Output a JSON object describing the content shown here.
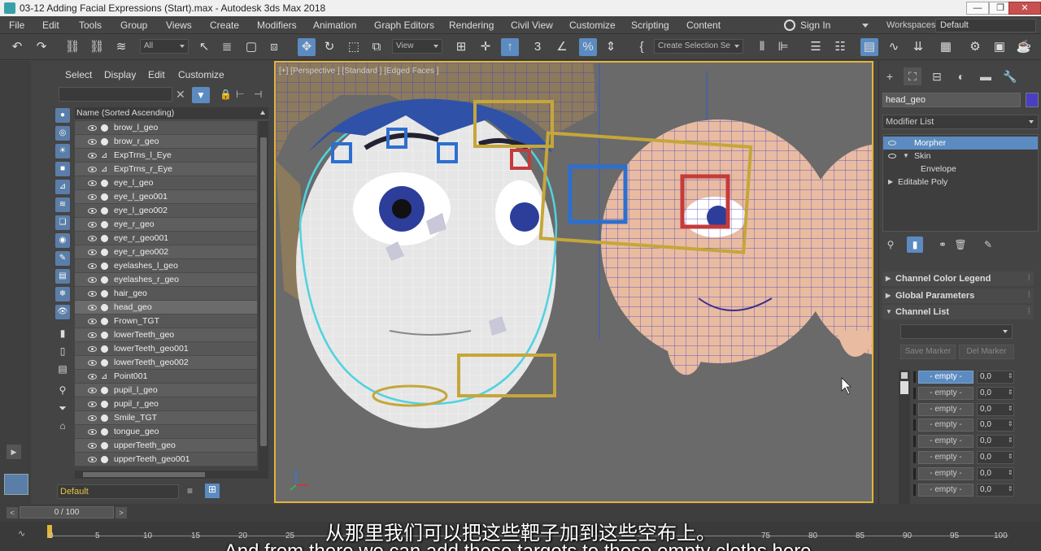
{
  "app": {
    "title": "03-12 Adding Facial Expressions (Start).max - Autodesk 3ds Max 2018",
    "window_buttons": [
      "—",
      "❐",
      "✕"
    ]
  },
  "menubar": {
    "items": [
      "File",
      "Edit",
      "Tools",
      "Group",
      "Views",
      "Create",
      "Modifiers",
      "Animation",
      "Graph Editors",
      "Rendering",
      "Civil View",
      "Customize",
      "Scripting",
      "Content"
    ],
    "sign_in": "Sign In",
    "workspaces_label": "Workspaces:",
    "workspace_value": "Default"
  },
  "toolbar": {
    "selection_filter": "All",
    "ref_coord": "View",
    "named_selection": "Create Selection Se",
    "snap_label": "3"
  },
  "scene_explorer": {
    "menu": [
      "Select",
      "Display",
      "Edit",
      "Customize"
    ],
    "header": "Name (Sorted Ascending)",
    "rows": [
      {
        "name": "brow_l_geo",
        "kind": "geo"
      },
      {
        "name": "brow_r_geo",
        "kind": "geo"
      },
      {
        "name": "ExpTrns_l_Eye",
        "kind": "helper"
      },
      {
        "name": "ExpTrns_r_Eye",
        "kind": "helper"
      },
      {
        "name": "eye_l_geo",
        "kind": "geo"
      },
      {
        "name": "eye_l_geo001",
        "kind": "geo"
      },
      {
        "name": "eye_l_geo002",
        "kind": "geo"
      },
      {
        "name": "eye_r_geo",
        "kind": "geo"
      },
      {
        "name": "eye_r_geo001",
        "kind": "geo"
      },
      {
        "name": "eye_r_geo002",
        "kind": "geo"
      },
      {
        "name": "eyelashes_l_geo",
        "kind": "geo"
      },
      {
        "name": "eyelashes_r_geo",
        "kind": "geo"
      },
      {
        "name": "hair_geo",
        "kind": "geo"
      },
      {
        "name": "head_geo",
        "kind": "geo",
        "selected": true
      },
      {
        "name": "Frown_TGT",
        "kind": "geo"
      },
      {
        "name": "lowerTeeth_geo",
        "kind": "geo"
      },
      {
        "name": "lowerTeeth_geo001",
        "kind": "geo"
      },
      {
        "name": "lowerTeeth_geo002",
        "kind": "geo"
      },
      {
        "name": "Point001",
        "kind": "helper"
      },
      {
        "name": "pupil_l_geo",
        "kind": "geo"
      },
      {
        "name": "pupil_r_geo",
        "kind": "geo"
      },
      {
        "name": "Smile_TGT",
        "kind": "geo"
      },
      {
        "name": "tongue_geo",
        "kind": "geo"
      },
      {
        "name": "upperTeeth_geo",
        "kind": "geo"
      },
      {
        "name": "upperTeeth_geo001",
        "kind": "geo"
      }
    ],
    "layer": "Default"
  },
  "viewport": {
    "label": "[+] [Perspective ] [Standard ] [Edged Faces ]"
  },
  "command_panel": {
    "object_name": "head_geo",
    "object_color": "#4a3fc2",
    "modifier_list": "Modifier List",
    "stack": [
      {
        "label": "Morpher",
        "selected": true
      },
      {
        "label": "Skin"
      },
      {
        "label": "Envelope"
      },
      {
        "label": "Editable Poly"
      }
    ],
    "rollouts": [
      "Channel Color Legend",
      "Global Parameters",
      "Channel List"
    ],
    "buttons": {
      "save_marker": "Save Marker",
      "del_marker": "Del Marker"
    },
    "channels": [
      {
        "name": "- empty -",
        "value": "0,0",
        "selected": true
      },
      {
        "name": "- empty -",
        "value": "0,0"
      },
      {
        "name": "- empty -",
        "value": "0,0"
      },
      {
        "name": "- empty -",
        "value": "0,0"
      },
      {
        "name": "- empty -",
        "value": "0,0"
      },
      {
        "name": "- empty -",
        "value": "0,0"
      },
      {
        "name": "- empty -",
        "value": "0,0"
      },
      {
        "name": "- empty -",
        "value": "0,0"
      }
    ]
  },
  "timeline": {
    "frame": "0 / 100",
    "ticks": [
      "0",
      "5",
      "10",
      "15",
      "20",
      "25",
      "75",
      "80",
      "85",
      "90",
      "95",
      "100"
    ]
  },
  "subtitles": {
    "cn": "从那里我们可以把这些靶子加到这些空布上。",
    "en": "And from there we can add these targets to these empty cloths here."
  }
}
